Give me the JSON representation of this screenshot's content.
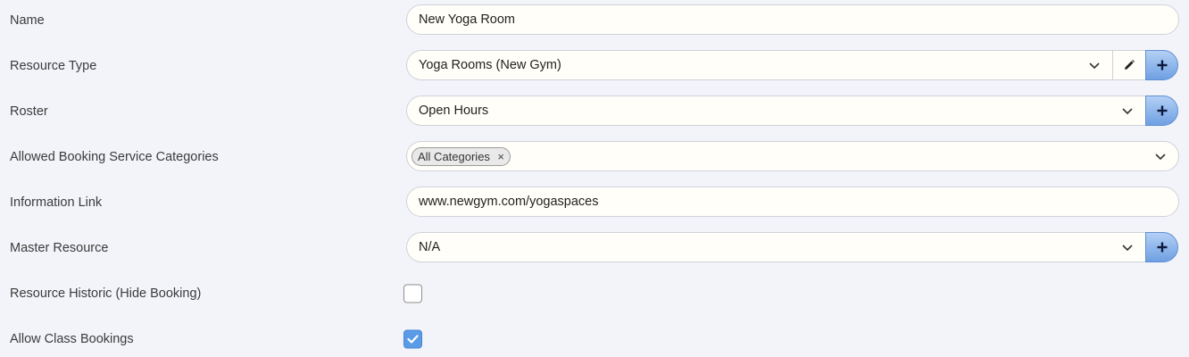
{
  "fields": {
    "name": {
      "label": "Name",
      "value": "New Yoga Room"
    },
    "resource_type": {
      "label": "Resource Type",
      "value": "Yoga Rooms (New Gym)"
    },
    "roster": {
      "label": "Roster",
      "value": "Open Hours"
    },
    "categories": {
      "label": "Allowed Booking Service Categories",
      "tags": [
        "All Categories"
      ],
      "remove_glyph": "×"
    },
    "info_link": {
      "label": "Information Link",
      "value": "www.newgym.com/yogaspaces"
    },
    "master_resource": {
      "label": "Master Resource",
      "value": "N/A"
    },
    "historic": {
      "label": "Resource Historic (Hide Booking)",
      "checked": false
    },
    "class_bookings": {
      "label": "Allow Class Bookings",
      "checked": true
    }
  },
  "icons": {
    "dropdown": "chevron-down-icon",
    "edit": "pencil-icon",
    "add": "plus-icon",
    "check": "check-icon"
  },
  "colors": {
    "background": "#f3f4fa",
    "input_bg": "#fffef8",
    "accent": "#5a9be8",
    "add_button": "#6fa0e2"
  }
}
